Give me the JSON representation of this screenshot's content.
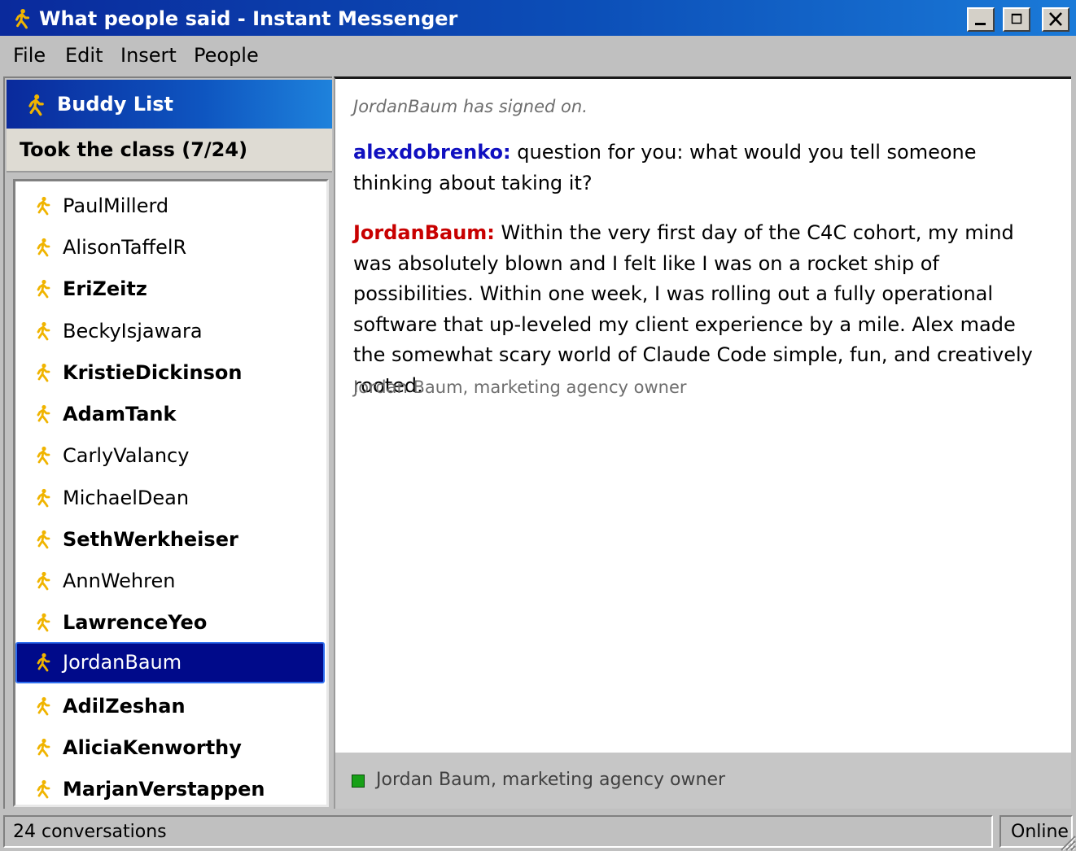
{
  "window": {
    "title": "What people said - Instant Messenger",
    "icon": "running-person-icon"
  },
  "menu": [
    "File",
    "Edit",
    "Insert",
    "People"
  ],
  "buddy_panel": {
    "title": "Buddy List",
    "group_label": "Took the class (7/24)",
    "buddies": [
      {
        "name": "PaulMillerd",
        "bold": false
      },
      {
        "name": "AlisonTaffelR",
        "bold": false
      },
      {
        "name": "EriZeitz",
        "bold": true
      },
      {
        "name": "BeckyIsjawara",
        "bold": false
      },
      {
        "name": "KristieDickinson",
        "bold": true
      },
      {
        "name": "AdamTank",
        "bold": true
      },
      {
        "name": "CarlyValancy",
        "bold": false
      },
      {
        "name": "MichaelDean",
        "bold": false
      },
      {
        "name": "SethWerkheiser",
        "bold": true
      },
      {
        "name": "AnnWehren",
        "bold": false
      },
      {
        "name": "LawrenceYeo",
        "bold": true
      },
      {
        "name": "JordanBaum",
        "bold": false,
        "selected": true
      },
      {
        "name": "AdilZeshan",
        "bold": true
      },
      {
        "name": "AliciaKenworthy",
        "bold": true
      },
      {
        "name": "MarjanVerstappen",
        "bold": true
      }
    ]
  },
  "chat": {
    "system_message": "JordanBaum has signed on.",
    "messages": [
      {
        "sender": "alexdobrenko:",
        "text": " question for you: what would you tell someone thinking about taking it?"
      },
      {
        "sender": "JordanBaum:",
        "text": " Within the very first day of the C4C cohort, my mind was absolutely blown and I felt like I was on a rocket ship of possibilities. Within one week, I was rolling out a fully operational software that up-leveled my client experience by a mile. Alex made the somewhat scary world of Claude Code simple, fun, and creatively rooted."
      }
    ],
    "attribution": "Jordan Baum, marketing agency owner",
    "status_line": "Jordan Baum, marketing agency owner"
  },
  "statusbar": {
    "left": "24 conversations",
    "right": "Online"
  },
  "colors": {
    "title_gradient_start": "#0a2a9c",
    "title_gradient_end": "#1a7ad8",
    "buddy_icon": "#f0b400",
    "selected_bg": "#000a8a",
    "sender_self": "#1010c0",
    "sender_other": "#c80000",
    "status_green": "#17a017"
  }
}
